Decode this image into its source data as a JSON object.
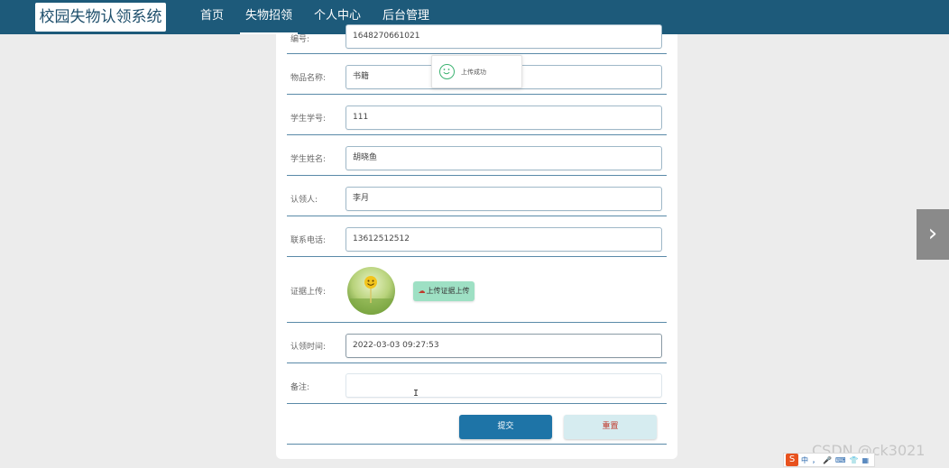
{
  "header": {
    "logo": "校园失物认领系统",
    "nav": [
      "首页",
      "失物招领",
      "个人中心",
      "后台管理"
    ],
    "active_index": 1
  },
  "form": {
    "fields": [
      {
        "label": "编号:",
        "value": "1648270661021"
      },
      {
        "label": "物品名称:",
        "value": "书籍"
      },
      {
        "label": "学生学号:",
        "value": "111"
      },
      {
        "label": "学生姓名:",
        "value": "胡晓鱼"
      },
      {
        "label": "认领人:",
        "value": "李月"
      },
      {
        "label": "联系电话:",
        "value": "13612512512"
      }
    ],
    "upload_label": "证据上传:",
    "upload_button": "上传证据上传",
    "time_label": "认领时间:",
    "time_value": "2022-03-03 09:27:53",
    "note_label": "备注:",
    "note_value": "",
    "submit": "提交",
    "reset": "重置"
  },
  "toast": {
    "message": "上传成功"
  },
  "watermark": "CSDN @ck3021",
  "ime": {
    "items": [
      "中",
      "，",
      "🎤",
      "⌨",
      "👕",
      "▦"
    ]
  },
  "colors": {
    "nav_bg": "#1d5a7a",
    "submit_bg": "#1e74a7",
    "reset_bg": "#d6ecf0",
    "upload_bg": "#9ee0c4",
    "success": "#3cb371"
  }
}
